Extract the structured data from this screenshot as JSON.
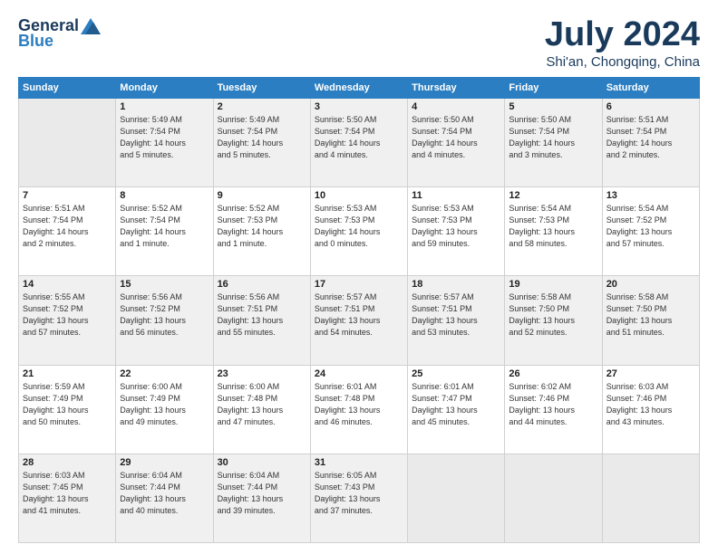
{
  "header": {
    "logo_general": "General",
    "logo_blue": "Blue",
    "title": "July 2024",
    "location": "Shi'an, Chongqing, China"
  },
  "weekdays": [
    "Sunday",
    "Monday",
    "Tuesday",
    "Wednesday",
    "Thursday",
    "Friday",
    "Saturday"
  ],
  "weeks": [
    [
      {
        "day": "",
        "info": ""
      },
      {
        "day": "1",
        "info": "Sunrise: 5:49 AM\nSunset: 7:54 PM\nDaylight: 14 hours\nand 5 minutes."
      },
      {
        "day": "2",
        "info": "Sunrise: 5:49 AM\nSunset: 7:54 PM\nDaylight: 14 hours\nand 5 minutes."
      },
      {
        "day": "3",
        "info": "Sunrise: 5:50 AM\nSunset: 7:54 PM\nDaylight: 14 hours\nand 4 minutes."
      },
      {
        "day": "4",
        "info": "Sunrise: 5:50 AM\nSunset: 7:54 PM\nDaylight: 14 hours\nand 4 minutes."
      },
      {
        "day": "5",
        "info": "Sunrise: 5:50 AM\nSunset: 7:54 PM\nDaylight: 14 hours\nand 3 minutes."
      },
      {
        "day": "6",
        "info": "Sunrise: 5:51 AM\nSunset: 7:54 PM\nDaylight: 14 hours\nand 2 minutes."
      }
    ],
    [
      {
        "day": "7",
        "info": "Sunrise: 5:51 AM\nSunset: 7:54 PM\nDaylight: 14 hours\nand 2 minutes."
      },
      {
        "day": "8",
        "info": "Sunrise: 5:52 AM\nSunset: 7:54 PM\nDaylight: 14 hours\nand 1 minute."
      },
      {
        "day": "9",
        "info": "Sunrise: 5:52 AM\nSunset: 7:53 PM\nDaylight: 14 hours\nand 1 minute."
      },
      {
        "day": "10",
        "info": "Sunrise: 5:53 AM\nSunset: 7:53 PM\nDaylight: 14 hours\nand 0 minutes."
      },
      {
        "day": "11",
        "info": "Sunrise: 5:53 AM\nSunset: 7:53 PM\nDaylight: 13 hours\nand 59 minutes."
      },
      {
        "day": "12",
        "info": "Sunrise: 5:54 AM\nSunset: 7:53 PM\nDaylight: 13 hours\nand 58 minutes."
      },
      {
        "day": "13",
        "info": "Sunrise: 5:54 AM\nSunset: 7:52 PM\nDaylight: 13 hours\nand 57 minutes."
      }
    ],
    [
      {
        "day": "14",
        "info": "Sunrise: 5:55 AM\nSunset: 7:52 PM\nDaylight: 13 hours\nand 57 minutes."
      },
      {
        "day": "15",
        "info": "Sunrise: 5:56 AM\nSunset: 7:52 PM\nDaylight: 13 hours\nand 56 minutes."
      },
      {
        "day": "16",
        "info": "Sunrise: 5:56 AM\nSunset: 7:51 PM\nDaylight: 13 hours\nand 55 minutes."
      },
      {
        "day": "17",
        "info": "Sunrise: 5:57 AM\nSunset: 7:51 PM\nDaylight: 13 hours\nand 54 minutes."
      },
      {
        "day": "18",
        "info": "Sunrise: 5:57 AM\nSunset: 7:51 PM\nDaylight: 13 hours\nand 53 minutes."
      },
      {
        "day": "19",
        "info": "Sunrise: 5:58 AM\nSunset: 7:50 PM\nDaylight: 13 hours\nand 52 minutes."
      },
      {
        "day": "20",
        "info": "Sunrise: 5:58 AM\nSunset: 7:50 PM\nDaylight: 13 hours\nand 51 minutes."
      }
    ],
    [
      {
        "day": "21",
        "info": "Sunrise: 5:59 AM\nSunset: 7:49 PM\nDaylight: 13 hours\nand 50 minutes."
      },
      {
        "day": "22",
        "info": "Sunrise: 6:00 AM\nSunset: 7:49 PM\nDaylight: 13 hours\nand 49 minutes."
      },
      {
        "day": "23",
        "info": "Sunrise: 6:00 AM\nSunset: 7:48 PM\nDaylight: 13 hours\nand 47 minutes."
      },
      {
        "day": "24",
        "info": "Sunrise: 6:01 AM\nSunset: 7:48 PM\nDaylight: 13 hours\nand 46 minutes."
      },
      {
        "day": "25",
        "info": "Sunrise: 6:01 AM\nSunset: 7:47 PM\nDaylight: 13 hours\nand 45 minutes."
      },
      {
        "day": "26",
        "info": "Sunrise: 6:02 AM\nSunset: 7:46 PM\nDaylight: 13 hours\nand 44 minutes."
      },
      {
        "day": "27",
        "info": "Sunrise: 6:03 AM\nSunset: 7:46 PM\nDaylight: 13 hours\nand 43 minutes."
      }
    ],
    [
      {
        "day": "28",
        "info": "Sunrise: 6:03 AM\nSunset: 7:45 PM\nDaylight: 13 hours\nand 41 minutes."
      },
      {
        "day": "29",
        "info": "Sunrise: 6:04 AM\nSunset: 7:44 PM\nDaylight: 13 hours\nand 40 minutes."
      },
      {
        "day": "30",
        "info": "Sunrise: 6:04 AM\nSunset: 7:44 PM\nDaylight: 13 hours\nand 39 minutes."
      },
      {
        "day": "31",
        "info": "Sunrise: 6:05 AM\nSunset: 7:43 PM\nDaylight: 13 hours\nand 37 minutes."
      },
      {
        "day": "",
        "info": ""
      },
      {
        "day": "",
        "info": ""
      },
      {
        "day": "",
        "info": ""
      }
    ]
  ]
}
